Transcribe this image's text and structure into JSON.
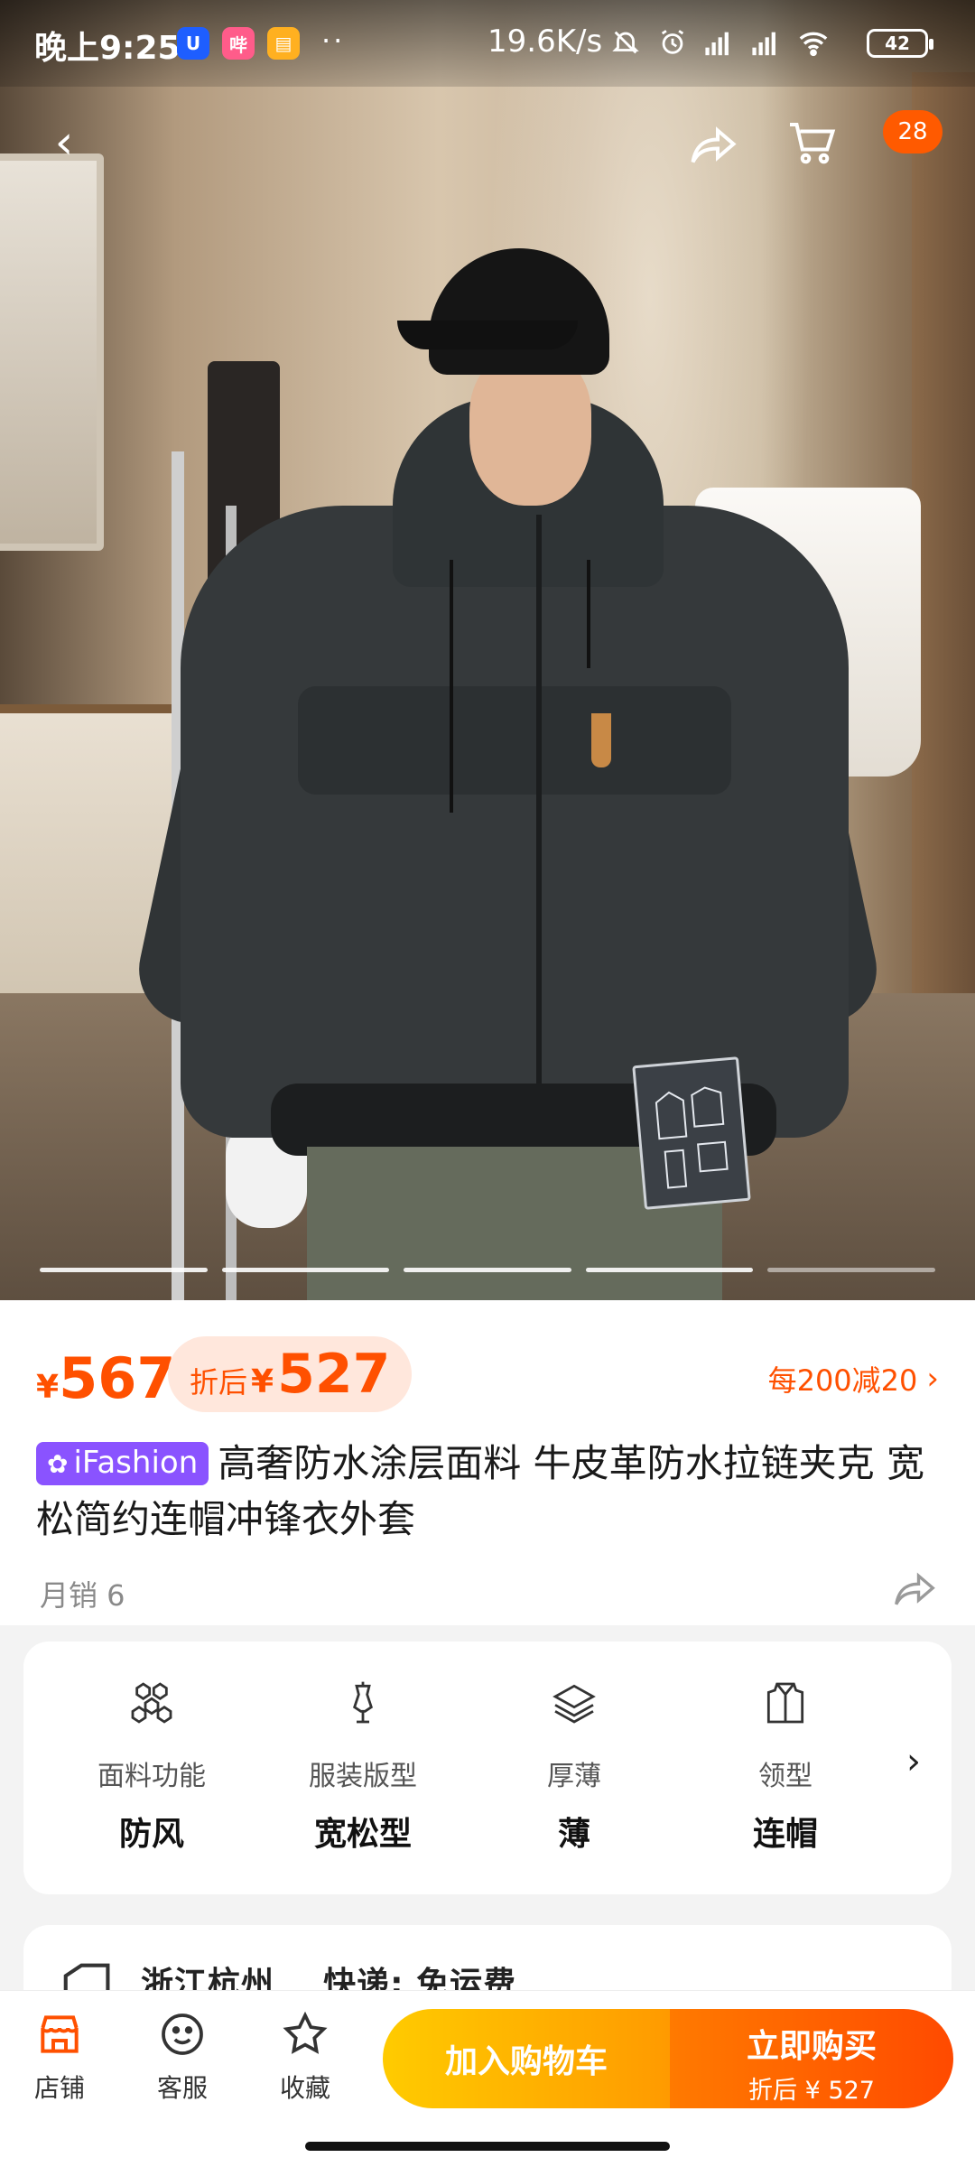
{
  "status_bar": {
    "time": "晚上9:25",
    "app_icons": [
      {
        "name": "u-app-icon",
        "glyph": "U",
        "color": "#1e5eff"
      },
      {
        "name": "bilibili-icon",
        "glyph": "哔",
        "color": "#ff5c8a"
      },
      {
        "name": "notes-app-icon",
        "glyph": "▤",
        "color": "#ffb020"
      }
    ],
    "dots": "··",
    "network_speed": "19.6K/s",
    "battery": "42"
  },
  "nav": {
    "back": "‹",
    "cart_badge": "28"
  },
  "gallery": {
    "image_count": 5,
    "active_index": 3
  },
  "price": {
    "currency": "¥",
    "original": "567",
    "discount_label": "折后",
    "discounted": "527",
    "coupon": "每200减20",
    "coupon_chevron": "›"
  },
  "product": {
    "brand": "iFashion",
    "brand_icon": "✿",
    "title": "高奢防水涂层面料 牛皮革防水拉链夹克 宽松简约连帽冲锋衣外套",
    "monthly_sales": "月销 6"
  },
  "attributes": [
    {
      "label": "面料功能",
      "value": "防风",
      "icon": "fabric-icon"
    },
    {
      "label": "服装版型",
      "value": "宽松型",
      "icon": "mannequin-icon"
    },
    {
      "label": "厚薄",
      "value": "薄",
      "icon": "layers-icon"
    },
    {
      "label": "领型",
      "value": "连帽",
      "icon": "collar-icon"
    }
  ],
  "attributes_more": "›",
  "shipping": {
    "origin": "浙江杭州",
    "delivery": "快递: 免运费"
  },
  "bottom_bar": {
    "shop": "店铺",
    "service": "客服",
    "favorite": "收藏",
    "add_to_cart": "加入购物车",
    "buy_now": "立即购买",
    "buy_now_sub": "折后 ¥ 527"
  },
  "colors": {
    "accent": "#ff5000",
    "brand_badge": "#8a53ff",
    "cart_button": "#ffb000",
    "buy_button": "#ff5a00"
  }
}
